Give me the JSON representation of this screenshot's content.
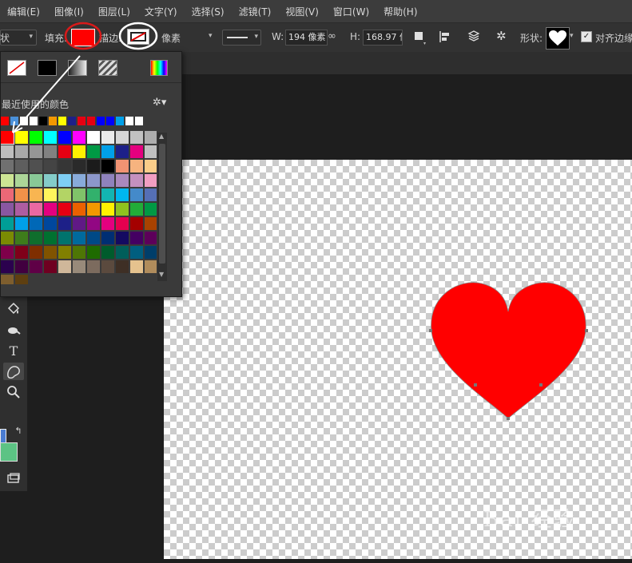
{
  "menu": [
    "编辑(E)",
    "图像(I)",
    "图层(L)",
    "文字(Y)",
    "选择(S)",
    "滤镜(T)",
    "视图(V)",
    "窗口(W)",
    "帮助(H)"
  ],
  "options": {
    "mode_label": "状",
    "fill_label": "填充:",
    "fill_color": "#ff0000",
    "stroke_label": "描边:",
    "units_value": "像素",
    "w_label": "W:",
    "w_value": "194 像素",
    "h_label": "H:",
    "h_value": "168.97 像",
    "shape_label": "形状:",
    "align_label": "对齐边缘"
  },
  "popup": {
    "recent_label": "最近使用的颜色",
    "recent_colors": [
      "#ff0000",
      "#4a90d9",
      "#ffffff",
      "#ffffff",
      "#000000",
      "#f39800",
      "#ffff00",
      "#1d2088",
      "#e60012",
      "#e60012",
      "#0000ff",
      "#0000ff",
      "#00a0e9",
      "#ffffff",
      "#ffffff"
    ],
    "swatches": [
      "#ff0000",
      "#ffff00",
      "#00ff00",
      "#00ffff",
      "#0000ff",
      "#ff00ff",
      "#ffffff",
      "#ebebeb",
      "#d6d6d6",
      "#c2c2c2",
      "#adadad",
      "#bebebe",
      "#a9a9a9",
      "#969696",
      "#818181",
      "#e60012",
      "#fff100",
      "#009944",
      "#00a0e9",
      "#1d2088",
      "#e4007f",
      "#c0c0c0",
      "#707070",
      "#5e5e5e",
      "#505050",
      "#444444",
      "#363636",
      "#2a2a2a",
      "#1b1b1b",
      "#000000",
      "#f19373",
      "#f6b37f",
      "#facd89",
      "#cde594",
      "#acd598",
      "#89c997",
      "#84ccc9",
      "#7ecef4",
      "#88abda",
      "#8c97cb",
      "#8f82bc",
      "#aa89bd",
      "#c490bf",
      "#f19ec2",
      "#eb6877",
      "#f19149",
      "#f8b551",
      "#fff45c",
      "#b3d465",
      "#80c269",
      "#32b16c",
      "#13b5b1",
      "#00b7ee",
      "#448aca",
      "#556fb5",
      "#8957a1",
      "#ae5da1",
      "#ea68a2",
      "#e4007f",
      "#e60012",
      "#eb6100",
      "#f39800",
      "#fff100",
      "#8fc31f",
      "#22ac38",
      "#009944",
      "#009e96",
      "#00a0e9",
      "#0068b7",
      "#00479d",
      "#1d2088",
      "#601986",
      "#920783",
      "#e4007f",
      "#e5004f",
      "#a40000",
      "#a84200",
      "#7b8b03",
      "#3e7c1b",
      "#0f6e2d",
      "#007130",
      "#00736d",
      "#006a9d",
      "#004986",
      "#002e73",
      "#140a61",
      "#440062",
      "#5d005a",
      "#7f004a",
      "#7f0019",
      "#7f2e00",
      "#805300",
      "#817f00",
      "#4e7605",
      "#1e6b00",
      "#005b2c",
      "#005e5a",
      "#005e7f",
      "#003e6a",
      "#2b014e",
      "#41003f",
      "#5f0046",
      "#6f0021",
      "#cfb79a",
      "#988a7a",
      "#7c6b5e",
      "#5b4a3e",
      "#3e2f25",
      "#e5c28e",
      "#b08c5c",
      "#7e5e2e",
      "#5e3f10"
    ]
  },
  "colors": {
    "heart": "#ff0000",
    "annotation_red": "#d81a1a",
    "fg": "#4a7cd1",
    "bg": "#5cc384"
  }
}
